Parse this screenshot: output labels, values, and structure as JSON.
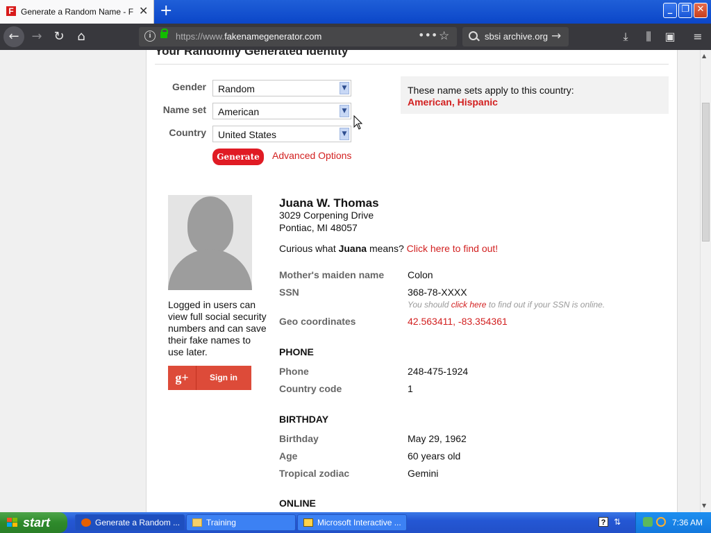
{
  "browser": {
    "tab_title": "Generate a Random Name - Fake Name Generator",
    "url_prefix": "https://www.",
    "url_domain": "fakenamegenerator.com",
    "search_value": "sbsi archive.org"
  },
  "page": {
    "heading": "Your Randomly Generated Identity",
    "form": {
      "gender_label": "Gender",
      "gender_value": "Random",
      "nameset_label": "Name set",
      "nameset_value": "American",
      "country_label": "Country",
      "country_value": "United States",
      "generate_label": "Generate",
      "advanced_label": "Advanced Options"
    },
    "namesets": {
      "text": "These name sets apply to this country:",
      "link1": "American",
      "sep": ", ",
      "link2": "Hispanic"
    },
    "sidebar": {
      "login_note": "Logged in users can view full social security numbers and can save their fake names to use later.",
      "gplus_icon": "g+",
      "signin_label": "Sign in"
    },
    "identity": {
      "name": "Juana W. Thomas",
      "street": "3029 Corpening Drive",
      "city": "Pontiac, MI 48057",
      "curious_pre": "Curious what ",
      "curious_name": "Juana",
      "curious_mid": " means? ",
      "curious_link": "Click here to find out!",
      "maiden_label": "Mother's maiden name",
      "maiden_value": "Colon",
      "ssn_label": "SSN",
      "ssn_value": "368-78-XXXX",
      "ssn_note_pre": "You should ",
      "ssn_note_link": "click here",
      "ssn_note_post": " to find out if your SSN is online.",
      "geo_label": "Geo coordinates",
      "geo_value": "42.563411, -83.354361",
      "phone_section": "PHONE",
      "phone_label": "Phone",
      "phone_value": "248-475-1924",
      "cc_label": "Country code",
      "cc_value": "1",
      "birthday_section": "BIRTHDAY",
      "birthday_label": "Birthday",
      "birthday_value": "May 29, 1962",
      "age_label": "Age",
      "age_value": "60 years old",
      "zodiac_label": "Tropical zodiac",
      "zodiac_value": "Gemini",
      "online_section": "ONLINE"
    }
  },
  "taskbar": {
    "start_label": "start",
    "tasks": [
      {
        "label": "Generate a Random ..."
      },
      {
        "label": "Training"
      },
      {
        "label": "Microsoft Interactive ..."
      }
    ],
    "clock": "7:36 AM"
  },
  "colors": {
    "accent_red": "#d21f1f",
    "generate_red": "#e01b24",
    "gplus_red": "#dd4b39"
  }
}
